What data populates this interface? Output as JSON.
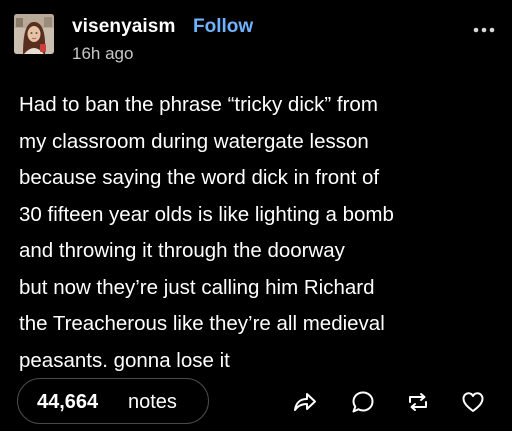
{
  "post": {
    "username": "visenyaism",
    "follow_label": "Follow",
    "timestamp": "16h ago",
    "body_lines": [
      "Had to ban the phrase “tricky dick” from",
      "my classroom during watergate lesson",
      "because saying the word dick in front of",
      "30 fifteen year olds is like lighting a bomb",
      "and throwing it through the doorway",
      "but now they’re just calling him Richard",
      "the Treacherous like they’re all medieval",
      "peasants. gonna lose it"
    ],
    "notes_count": "44,664",
    "notes_label": "notes"
  },
  "icons": {
    "more": "more-dots-icon",
    "share": "share-arrow-icon",
    "reply": "reply-bubble-icon",
    "reblog": "reblog-icon",
    "like": "heart-icon"
  },
  "colors": {
    "background": "#000000",
    "text": "#ffffff",
    "follow": "#6fb2ff",
    "muted": "#c8c8c8",
    "pill_border": "#4a4a4a"
  }
}
